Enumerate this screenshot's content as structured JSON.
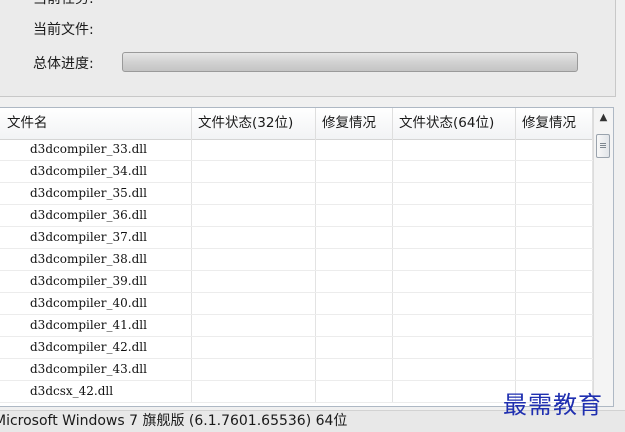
{
  "status_panel": {
    "current_task_label": "当前任务:",
    "current_file_label": "当前文件:",
    "overall_progress_label": "总体进度:",
    "overall_progress": 0
  },
  "table": {
    "columns": [
      "文件名",
      "文件状态(32位)",
      "修复情况",
      "文件状态(64位)",
      "修复情况"
    ],
    "rows": [
      {
        "filename": "d3dcompiler_33.dll"
      },
      {
        "filename": "d3dcompiler_34.dll"
      },
      {
        "filename": "d3dcompiler_35.dll"
      },
      {
        "filename": "d3dcompiler_36.dll"
      },
      {
        "filename": "d3dcompiler_37.dll"
      },
      {
        "filename": "d3dcompiler_38.dll"
      },
      {
        "filename": "d3dcompiler_39.dll"
      },
      {
        "filename": "d3dcompiler_40.dll"
      },
      {
        "filename": "d3dcompiler_41.dll"
      },
      {
        "filename": "d3dcompiler_42.dll"
      },
      {
        "filename": "d3dcompiler_43.dll"
      },
      {
        "filename": "d3dcsx_42.dll"
      }
    ]
  },
  "scrollbar": {
    "up_arrow_icon": "chevron-up-icon"
  },
  "footer": {
    "os_info": "Microsoft Windows 7 旗舰版 (6.1.7601.65536) 64位"
  },
  "watermark": {
    "text": "最需教育"
  },
  "colors": {
    "watermark": "#1f2fb0",
    "table_border": "#aeb8c4"
  }
}
